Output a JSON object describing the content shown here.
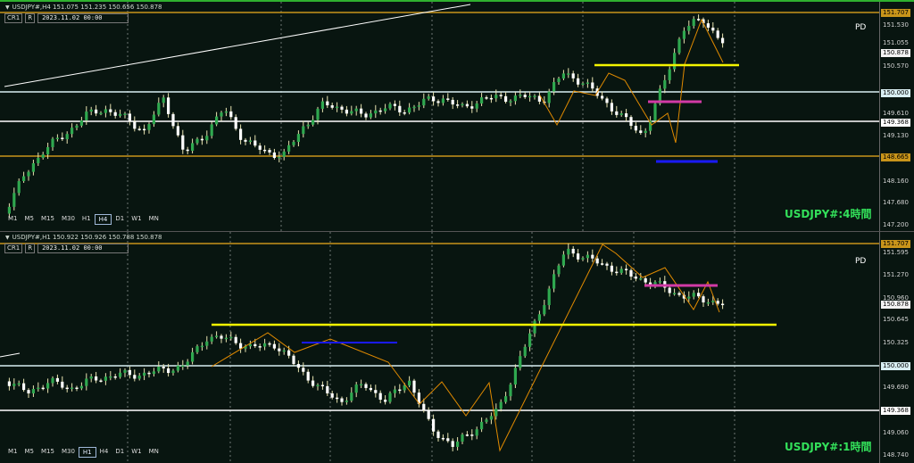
{
  "top": {
    "header": "USDJPY#,H4  151.075 151.235 150.656 150.878",
    "cr": "CR1",
    "r": "R",
    "date": "2023.11.02  00:00",
    "pd": "PD",
    "watermark": "USDJPY#:4時間",
    "timeframes": [
      "M1",
      "M5",
      "M15",
      "M30",
      "H1",
      "H4",
      "D1",
      "W1",
      "MN"
    ],
    "active_tf": "H4",
    "ticks": [
      "151.530",
      "151.055",
      "150.570",
      "149.610",
      "149.130",
      "148.160",
      "147.680",
      "147.200"
    ],
    "boxes": [
      {
        "text": "151.707",
        "bg": "#c8941a",
        "fg": "#000"
      },
      {
        "text": "150.878",
        "bg": "#f2f2f2",
        "fg": "#000"
      },
      {
        "text": "150.000",
        "bg": "#d8eef2",
        "fg": "#000"
      },
      {
        "text": "149.368",
        "bg": "#ffffff",
        "fg": "#000"
      },
      {
        "text": "148.665",
        "bg": "#c8941a",
        "fg": "#000"
      }
    ]
  },
  "bottom": {
    "header": "USDJPY#,H1  150.922 150.926 150.788 150.878",
    "cr": "CR1",
    "r": "R",
    "date": "2023.11.02  00:00",
    "pd": "PD",
    "watermark": "USDJPY#:1時間",
    "timeframes": [
      "M1",
      "M5",
      "M15",
      "M30",
      "H1",
      "H4",
      "D1",
      "W1",
      "MN"
    ],
    "active_tf": "H1",
    "ticks": [
      "151.595",
      "151.270",
      "150.960",
      "150.645",
      "150.325",
      "149.690",
      "149.060",
      "148.740"
    ],
    "boxes": [
      {
        "text": "151.707",
        "bg": "#c8941a",
        "fg": "#000"
      },
      {
        "text": "150.878",
        "bg": "#f2f2f2",
        "fg": "#000"
      },
      {
        "text": "150.000",
        "bg": "#d8eef2",
        "fg": "#000"
      },
      {
        "text": "149.368",
        "bg": "#ffffff",
        "fg": "#000"
      }
    ]
  },
  "colors": {
    "background": "#081510",
    "bull": "#2fa84f",
    "bear": "#ffffff",
    "wick": "#e8e3b0",
    "orange": "#c8941a",
    "yellow": "#f4f400",
    "magenta": "#d23aa6",
    "blue": "#1a1aff",
    "zigzag": "#e08a00"
  }
}
